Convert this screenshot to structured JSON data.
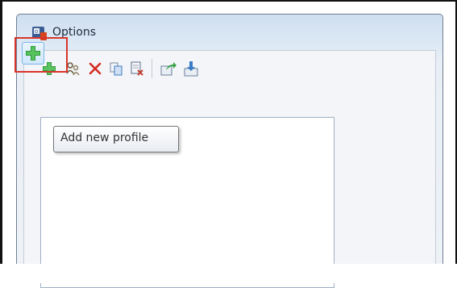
{
  "window": {
    "title": "Options"
  },
  "toolbar": {
    "buttons": [
      {
        "name": "add-profile",
        "icon": "plus-icon",
        "color": "#2e9b3a"
      },
      {
        "name": "duplicate-profile",
        "icon": "profiles-icon",
        "color": "#7a6a4a"
      },
      {
        "name": "delete-profile",
        "icon": "close-icon",
        "color": "#d42b22"
      },
      {
        "name": "copy-profile",
        "icon": "copy-icon",
        "color": "#3b7dc4"
      },
      {
        "name": "remove-profile",
        "icon": "document-delete-icon",
        "color": "#c23a2e"
      },
      {
        "name": "export-profile",
        "icon": "export-icon",
        "color": "#2e9b3a"
      },
      {
        "name": "import-profile",
        "icon": "import-icon",
        "color": "#3b7dc4"
      }
    ]
  },
  "tooltip": {
    "text": "Add new profile"
  },
  "colors": {
    "highlight": "#d9342b",
    "accent": "#2e9b3a"
  }
}
